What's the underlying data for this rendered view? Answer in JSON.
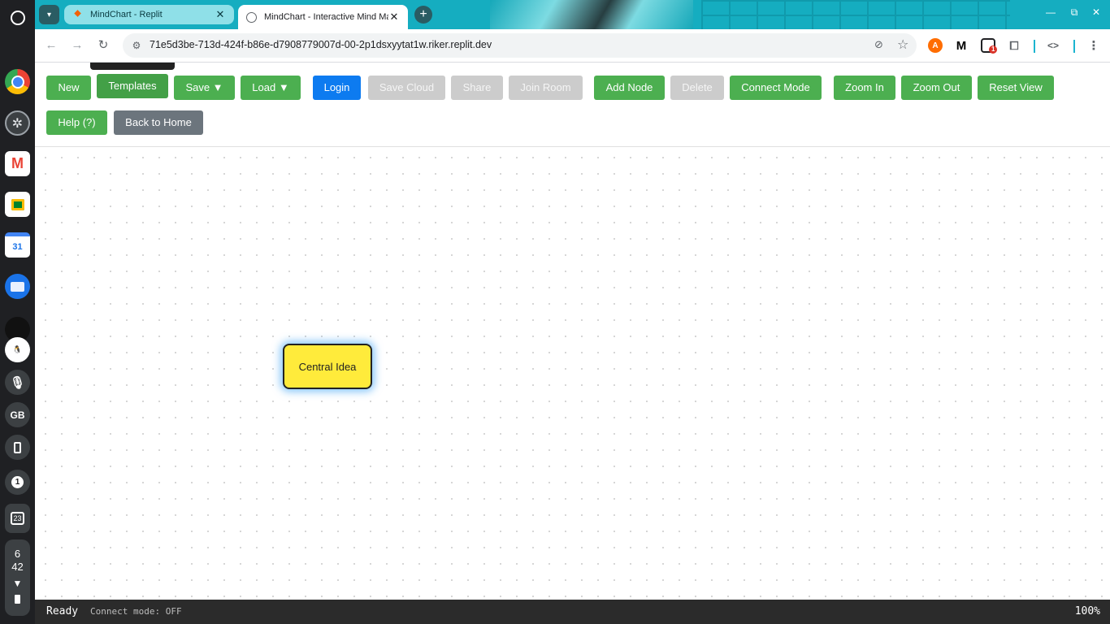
{
  "shelf": {
    "gb_label": "GB",
    "calendar_day_icon": "23",
    "calendar_app_day": "31",
    "notification_count": "1",
    "clock_hour": "6",
    "clock_minute": "42"
  },
  "browser": {
    "tabs": [
      {
        "title": "MindChart - Replit",
        "favicon": "replit-icon"
      },
      {
        "title": "MindChart - Interactive Mind Map",
        "favicon": "globe-icon",
        "active": true
      }
    ],
    "url": "71e5d3be-713d-424f-b86e-d7908779007d-00-2p1dsxyytat1w.riker.replit.dev",
    "extension_badge": "1"
  },
  "toolbar": {
    "row1": [
      {
        "id": "new",
        "label": "New",
        "style": "green"
      },
      {
        "id": "templates",
        "label": "Templates",
        "style": "green-dark"
      },
      {
        "id": "save",
        "label": "Save ▼",
        "style": "green"
      },
      {
        "id": "load",
        "label": "Load ▼",
        "style": "green"
      },
      {
        "id": "login",
        "label": "Login",
        "style": "blue"
      },
      {
        "id": "save-cloud",
        "label": "Save Cloud",
        "style": "disabled"
      },
      {
        "id": "share",
        "label": "Share",
        "style": "disabled"
      },
      {
        "id": "join-room",
        "label": "Join Room",
        "style": "disabled"
      },
      {
        "id": "add-node",
        "label": "Add Node",
        "style": "green"
      },
      {
        "id": "delete",
        "label": "Delete",
        "style": "disabled"
      },
      {
        "id": "connect-mode",
        "label": "Connect Mode",
        "style": "green"
      },
      {
        "id": "zoom-in",
        "label": "Zoom In",
        "style": "green"
      },
      {
        "id": "zoom-out",
        "label": "Zoom Out",
        "style": "green"
      },
      {
        "id": "reset-view",
        "label": "Reset View",
        "style": "green"
      }
    ],
    "row2": [
      {
        "id": "help",
        "label": "Help (?)",
        "style": "green"
      },
      {
        "id": "back-home",
        "label": "Back to Home",
        "style": "grey"
      }
    ]
  },
  "canvas": {
    "nodes": [
      {
        "label": "Central Idea",
        "color": "#ffeb3b",
        "selected": true
      }
    ]
  },
  "status": {
    "state": "Ready",
    "connect_mode": "Connect mode: OFF",
    "zoom": "100%"
  },
  "colors": {
    "button_green": "#4caf50",
    "button_blue": "#0d7bf0",
    "button_disabled": "#cccccc",
    "button_grey": "#6c757d",
    "node_yellow": "#ffeb3b",
    "statusbar_bg": "#2b2b2b"
  }
}
